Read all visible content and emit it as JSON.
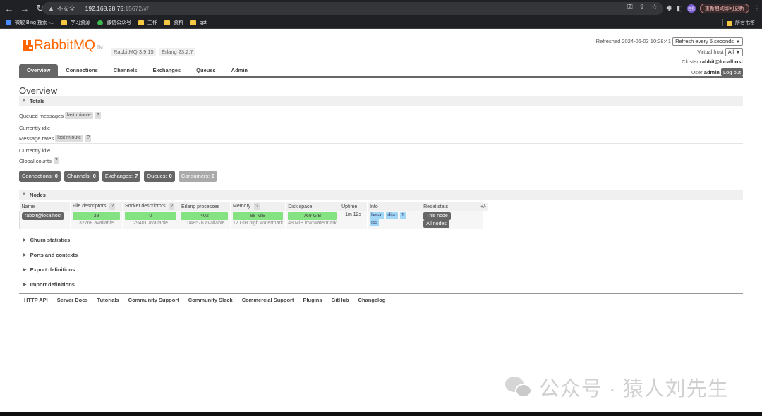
{
  "browser": {
    "url_warning": "不安全",
    "url_host": "192.168.28.75",
    "url_rest": ":15672/#/",
    "avatar_text": "自我",
    "update_button": "重新启动即可更新",
    "bookmarks": [
      {
        "label": "微软 Bing 搜索 -...",
        "icon": "bing-icon"
      },
      {
        "label": "学习资源",
        "icon": "folder-icon"
      },
      {
        "label": "微信公众号",
        "icon": "wechat-icon"
      },
      {
        "label": "工作",
        "icon": "folder-icon"
      },
      {
        "label": "资料",
        "icon": "folder-icon"
      },
      {
        "label": "gpt",
        "icon": "folder-icon"
      }
    ],
    "all_bookmarks": "所有书签"
  },
  "header": {
    "logo_text": "RabbitMQ",
    "logo_tm": "TM",
    "rabbitmq_version": "RabbitMQ 3.9.15",
    "erlang_version": "Erlang 23.2.7",
    "refreshed_label": "Refreshed 2024-06-03 10:28:41",
    "refresh_select": "Refresh every 5 seconds",
    "vhost_label": "Virtual host",
    "vhost_select": "All",
    "cluster_label": "Cluster",
    "cluster_value": "rabbit@localhost",
    "user_label": "User",
    "user_value": "admin",
    "logout": "Log out"
  },
  "tabs": [
    "Overview",
    "Connections",
    "Channels",
    "Exchanges",
    "Queues",
    "Admin"
  ],
  "page_title": "Overview",
  "totals": {
    "section_title": "Totals",
    "queued_messages_label": "Queued messages",
    "queued_messages_pill": "last minute",
    "queued_idle": "Currently idle",
    "message_rates_label": "Message rates",
    "message_rates_pill": "last minute",
    "rates_idle": "Currently idle",
    "global_counts_label": "Global counts",
    "help": "?"
  },
  "counts": [
    {
      "label": "Connections:",
      "value": "0"
    },
    {
      "label": "Channels:",
      "value": "0"
    },
    {
      "label": "Exchanges:",
      "value": "7"
    },
    {
      "label": "Queues:",
      "value": "0"
    },
    {
      "label": "Consumers:",
      "value": "0"
    }
  ],
  "nodes": {
    "section_title": "Nodes",
    "columns": [
      "Name",
      "File descriptors",
      "Socket descriptors",
      "Erlang processes",
      "Memory",
      "Disk space",
      "Uptime",
      "Info",
      "Reset stats"
    ],
    "row": {
      "name": "rabbit@localhost",
      "file_descriptors": "38",
      "file_descriptors_sub": "32768 available",
      "socket_descriptors": "0",
      "socket_descriptors_sub": "29401 available",
      "erlang_processes": "402",
      "erlang_processes_sub": "1048576 available",
      "memory": "88 MiB",
      "memory_sub": "12 GiB high watermark",
      "disk_space": "769 GiB",
      "disk_space_sub": "48 MiB low watermark",
      "uptime": "1m 12s",
      "info_tags": [
        "basic",
        "disc",
        "1",
        "rss"
      ],
      "reset_this": "This node",
      "reset_all": "All nodes"
    },
    "plus_minus": "+/-"
  },
  "collapsibles": [
    "Churn statistics",
    "Ports and contexts",
    "Export definitions",
    "Import definitions"
  ],
  "footer_links": [
    "HTTP API",
    "Server Docs",
    "Tutorials",
    "Community Support",
    "Community Slack",
    "Commercial Support",
    "Plugins",
    "GitHub",
    "Changelog"
  ],
  "watermark": "公众号 · 猿人刘先生",
  "colors": {
    "brand": "#ff6600",
    "tab_active": "#666666",
    "gauge_green": "#84e283",
    "info_blue": "#9fd7f5"
  }
}
